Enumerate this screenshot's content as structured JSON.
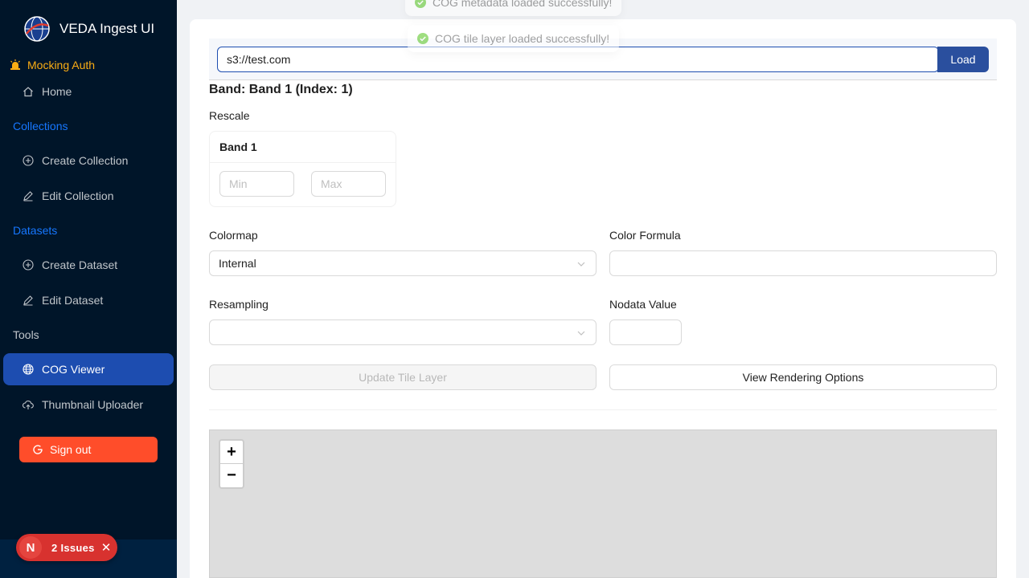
{
  "sidebar": {
    "brand": "VEDA Ingest UI",
    "auth": "Mocking Auth",
    "home": "Home",
    "collections_group": "Collections",
    "create_collection": "Create Collection",
    "edit_collection": "Edit Collection",
    "datasets_group": "Datasets",
    "create_dataset": "Create Dataset",
    "edit_dataset": "Edit Dataset",
    "tools_group": "Tools",
    "cog_viewer": "COG Viewer",
    "thumbnail_uploader": "Thumbnail Uploader",
    "sign_out": "Sign out"
  },
  "issues": {
    "logo": "N",
    "label": "2 Issues"
  },
  "toasts": {
    "metadata": "COG metadata loaded successfully!",
    "tile_layer": "COG tile layer loaded successfully!"
  },
  "url": {
    "value": "s3://test.com",
    "load_label": "Load"
  },
  "band": {
    "title": "Band: Band 1 (Index: 1)",
    "rescale_label": "Rescale",
    "card_title": "Band 1",
    "min_placeholder": "Min",
    "max_placeholder": "Max"
  },
  "form": {
    "colormap_label": "Colormap",
    "colormap_value": "Internal",
    "color_formula_label": "Color Formula",
    "color_formula_value": "",
    "resampling_label": "Resampling",
    "resampling_value": "",
    "nodata_label": "Nodata Value",
    "nodata_value": ""
  },
  "buttons": {
    "update": "Update Tile Layer",
    "view_rendering": "View Rendering Options"
  },
  "map": {
    "zoom_in": "+",
    "zoom_out": "−"
  },
  "colors": {
    "sidebar_bg": "#001529",
    "active_item": "#1d4db0",
    "primary": "#2a4f9e",
    "signout": "#ff4d2a",
    "group_label": "#1677ff",
    "auth_warning": "#faad14",
    "success": "#52c41a"
  }
}
